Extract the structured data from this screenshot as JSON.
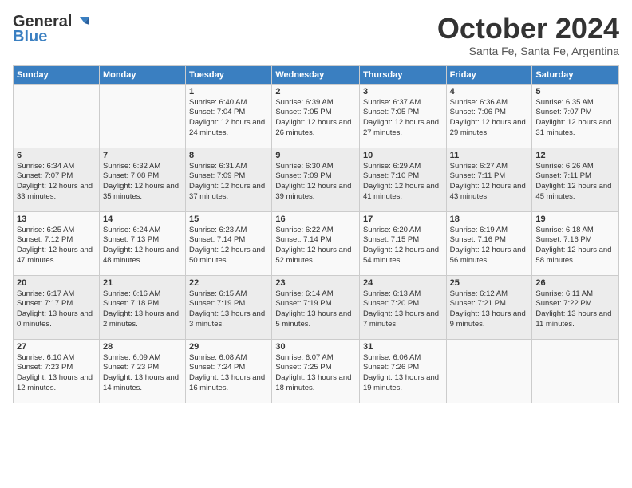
{
  "logo": {
    "general": "General",
    "blue": "Blue"
  },
  "header": {
    "month": "October 2024",
    "location": "Santa Fe, Santa Fe, Argentina"
  },
  "weekdays": [
    "Sunday",
    "Monday",
    "Tuesday",
    "Wednesday",
    "Thursday",
    "Friday",
    "Saturday"
  ],
  "weeks": [
    [
      {
        "day": "",
        "detail": ""
      },
      {
        "day": "",
        "detail": ""
      },
      {
        "day": "1",
        "detail": "Sunrise: 6:40 AM\nSunset: 7:04 PM\nDaylight: 12 hours and 24 minutes."
      },
      {
        "day": "2",
        "detail": "Sunrise: 6:39 AM\nSunset: 7:05 PM\nDaylight: 12 hours and 26 minutes."
      },
      {
        "day": "3",
        "detail": "Sunrise: 6:37 AM\nSunset: 7:05 PM\nDaylight: 12 hours and 27 minutes."
      },
      {
        "day": "4",
        "detail": "Sunrise: 6:36 AM\nSunset: 7:06 PM\nDaylight: 12 hours and 29 minutes."
      },
      {
        "day": "5",
        "detail": "Sunrise: 6:35 AM\nSunset: 7:07 PM\nDaylight: 12 hours and 31 minutes."
      }
    ],
    [
      {
        "day": "6",
        "detail": "Sunrise: 6:34 AM\nSunset: 7:07 PM\nDaylight: 12 hours and 33 minutes."
      },
      {
        "day": "7",
        "detail": "Sunrise: 6:32 AM\nSunset: 7:08 PM\nDaylight: 12 hours and 35 minutes."
      },
      {
        "day": "8",
        "detail": "Sunrise: 6:31 AM\nSunset: 7:09 PM\nDaylight: 12 hours and 37 minutes."
      },
      {
        "day": "9",
        "detail": "Sunrise: 6:30 AM\nSunset: 7:09 PM\nDaylight: 12 hours and 39 minutes."
      },
      {
        "day": "10",
        "detail": "Sunrise: 6:29 AM\nSunset: 7:10 PM\nDaylight: 12 hours and 41 minutes."
      },
      {
        "day": "11",
        "detail": "Sunrise: 6:27 AM\nSunset: 7:11 PM\nDaylight: 12 hours and 43 minutes."
      },
      {
        "day": "12",
        "detail": "Sunrise: 6:26 AM\nSunset: 7:11 PM\nDaylight: 12 hours and 45 minutes."
      }
    ],
    [
      {
        "day": "13",
        "detail": "Sunrise: 6:25 AM\nSunset: 7:12 PM\nDaylight: 12 hours and 47 minutes."
      },
      {
        "day": "14",
        "detail": "Sunrise: 6:24 AM\nSunset: 7:13 PM\nDaylight: 12 hours and 48 minutes."
      },
      {
        "day": "15",
        "detail": "Sunrise: 6:23 AM\nSunset: 7:14 PM\nDaylight: 12 hours and 50 minutes."
      },
      {
        "day": "16",
        "detail": "Sunrise: 6:22 AM\nSunset: 7:14 PM\nDaylight: 12 hours and 52 minutes."
      },
      {
        "day": "17",
        "detail": "Sunrise: 6:20 AM\nSunset: 7:15 PM\nDaylight: 12 hours and 54 minutes."
      },
      {
        "day": "18",
        "detail": "Sunrise: 6:19 AM\nSunset: 7:16 PM\nDaylight: 12 hours and 56 minutes."
      },
      {
        "day": "19",
        "detail": "Sunrise: 6:18 AM\nSunset: 7:16 PM\nDaylight: 12 hours and 58 minutes."
      }
    ],
    [
      {
        "day": "20",
        "detail": "Sunrise: 6:17 AM\nSunset: 7:17 PM\nDaylight: 13 hours and 0 minutes."
      },
      {
        "day": "21",
        "detail": "Sunrise: 6:16 AM\nSunset: 7:18 PM\nDaylight: 13 hours and 2 minutes."
      },
      {
        "day": "22",
        "detail": "Sunrise: 6:15 AM\nSunset: 7:19 PM\nDaylight: 13 hours and 3 minutes."
      },
      {
        "day": "23",
        "detail": "Sunrise: 6:14 AM\nSunset: 7:19 PM\nDaylight: 13 hours and 5 minutes."
      },
      {
        "day": "24",
        "detail": "Sunrise: 6:13 AM\nSunset: 7:20 PM\nDaylight: 13 hours and 7 minutes."
      },
      {
        "day": "25",
        "detail": "Sunrise: 6:12 AM\nSunset: 7:21 PM\nDaylight: 13 hours and 9 minutes."
      },
      {
        "day": "26",
        "detail": "Sunrise: 6:11 AM\nSunset: 7:22 PM\nDaylight: 13 hours and 11 minutes."
      }
    ],
    [
      {
        "day": "27",
        "detail": "Sunrise: 6:10 AM\nSunset: 7:23 PM\nDaylight: 13 hours and 12 minutes."
      },
      {
        "day": "28",
        "detail": "Sunrise: 6:09 AM\nSunset: 7:23 PM\nDaylight: 13 hours and 14 minutes."
      },
      {
        "day": "29",
        "detail": "Sunrise: 6:08 AM\nSunset: 7:24 PM\nDaylight: 13 hours and 16 minutes."
      },
      {
        "day": "30",
        "detail": "Sunrise: 6:07 AM\nSunset: 7:25 PM\nDaylight: 13 hours and 18 minutes."
      },
      {
        "day": "31",
        "detail": "Sunrise: 6:06 AM\nSunset: 7:26 PM\nDaylight: 13 hours and 19 minutes."
      },
      {
        "day": "",
        "detail": ""
      },
      {
        "day": "",
        "detail": ""
      }
    ]
  ]
}
